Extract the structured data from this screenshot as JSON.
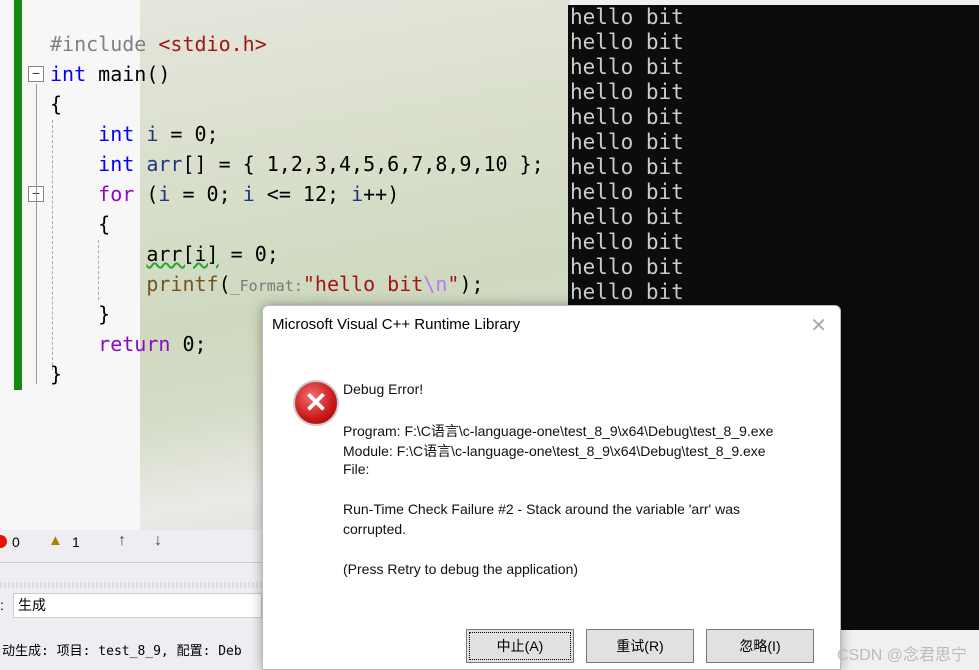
{
  "editor": {
    "lines": [
      [
        [
          "pre",
          "#include "
        ],
        [
          "inc",
          "<stdio.h>"
        ]
      ],
      [
        [
          "kw",
          "int"
        ],
        [
          "plain",
          " main()"
        ]
      ],
      [
        [
          "plain",
          "{"
        ]
      ],
      [
        [
          "plain",
          "    "
        ],
        [
          "kw",
          "int"
        ],
        [
          "plain",
          " "
        ],
        [
          "var",
          "i"
        ],
        [
          "plain",
          " = 0;"
        ]
      ],
      [
        [
          "plain",
          "    "
        ],
        [
          "kw",
          "int"
        ],
        [
          "plain",
          " "
        ],
        [
          "var",
          "arr"
        ],
        [
          "plain",
          "[] = { 1,2,3,4,5,6,7,8,9,10 };"
        ]
      ],
      [
        [
          "plain",
          "    "
        ],
        [
          "ctl",
          "for"
        ],
        [
          "plain",
          " ("
        ],
        [
          "var",
          "i"
        ],
        [
          "plain",
          " = 0; "
        ],
        [
          "var",
          "i"
        ],
        [
          "plain",
          " <= 12; "
        ],
        [
          "var",
          "i"
        ],
        [
          "plain",
          "++)"
        ]
      ],
      [
        [
          "plain",
          "    {"
        ]
      ],
      [
        [
          "plain",
          "        "
        ],
        [
          "squig",
          "arr[i]"
        ],
        [
          "plain",
          " = 0;"
        ]
      ],
      [
        [
          "plain",
          "        "
        ],
        [
          "fn",
          "printf"
        ],
        [
          "plain",
          "("
        ],
        [
          "hint",
          "_Format:"
        ],
        [
          "str",
          "\"hello bit"
        ],
        [
          "esc",
          "\\n"
        ],
        [
          "str",
          "\""
        ],
        [
          "plain",
          ");"
        ]
      ],
      [
        [
          "plain",
          "    }"
        ]
      ],
      [
        [
          "plain",
          "    "
        ],
        [
          "ctl",
          "return"
        ],
        [
          "plain",
          " 0;"
        ]
      ],
      [
        [
          "plain",
          "}"
        ]
      ]
    ]
  },
  "console": {
    "lines": [
      "hello bit",
      "hello bit",
      "hello bit",
      "hello bit",
      "hello bit",
      "hello bit",
      "hello bit",
      "hello bit",
      "hello bit",
      "hello bit",
      "hello bit",
      "hello bit"
    ]
  },
  "error_list": {
    "errors": "0",
    "warnings": "1"
  },
  "output": {
    "label": ":",
    "source": "生成",
    "text": "动生成: 项目: test_8_9, 配置: Deb"
  },
  "dialog": {
    "title": "Microsoft Visual C++ Runtime Library",
    "heading": "Debug Error!",
    "program": "Program: F:\\C语言\\c-language-one\\test_8_9\\x64\\Debug\\test_8_9.exe",
    "module": "Module: F:\\C语言\\c-language-one\\test_8_9\\x64\\Debug\\test_8_9.exe",
    "file": "File:",
    "message1": "Run-Time Check Failure #2 - Stack around the variable 'arr' was",
    "message2": "corrupted.",
    "hint": "(Press Retry to debug the application)",
    "buttons": {
      "abort": "中止(A)",
      "retry": "重试(R)",
      "ignore": "忽略(I)"
    }
  },
  "watermark": "CSDN @念君思宁"
}
